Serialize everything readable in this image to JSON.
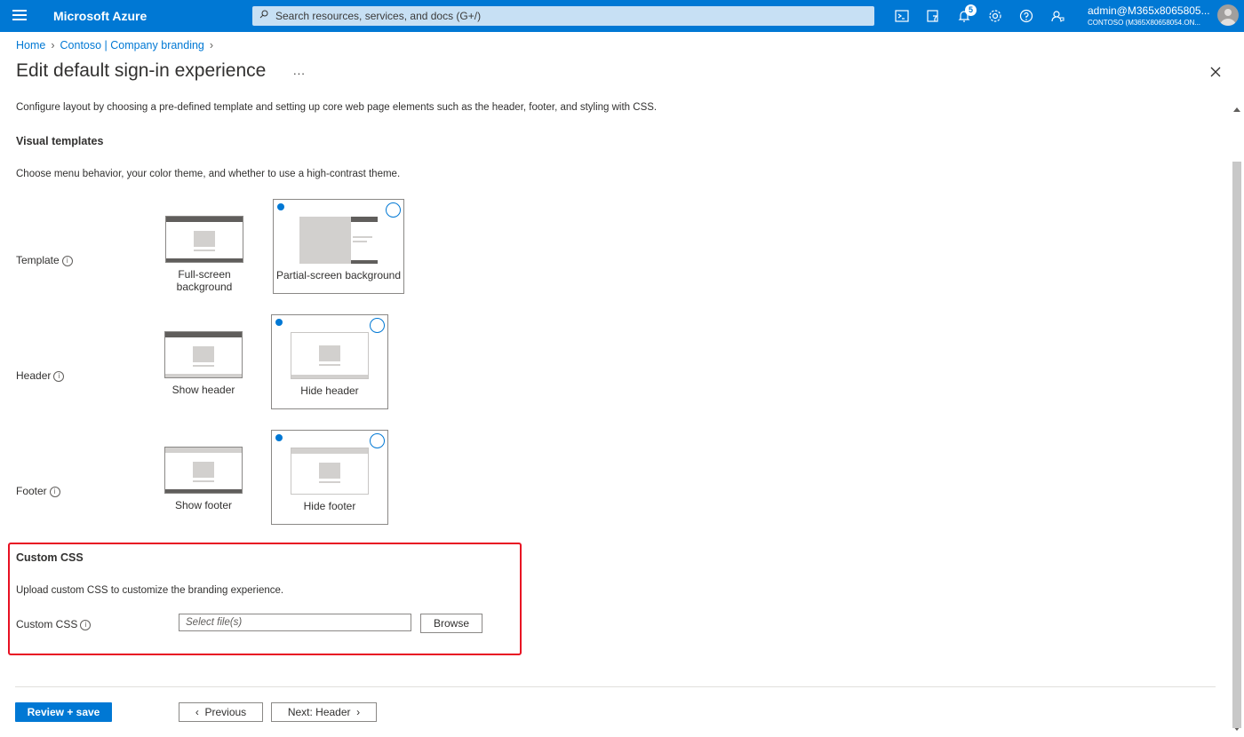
{
  "topbar": {
    "brand": "Microsoft Azure",
    "search_placeholder": "Search resources, services, and docs (G+/)",
    "notification_count": "5",
    "account_user": "admin@M365x8065805...",
    "account_tenant": "CONTOSO (M365X80658054.ON...",
    "icons": [
      "hamburger-icon",
      "search-icon",
      "cloud-shell-icon",
      "directory-filter-icon",
      "notifications-icon",
      "settings-icon",
      "help-icon",
      "feedback-icon",
      "avatar"
    ],
    "color": "#0078d4"
  },
  "breadcrumb": {
    "home": "Home",
    "parent": "Contoso | Company branding"
  },
  "page": {
    "title": "Edit default sign-in experience",
    "more": "...",
    "description": "Configure layout by choosing a pre-defined template and setting up core web page elements such as the header, footer, and styling with CSS."
  },
  "visual_templates": {
    "heading": "Visual templates",
    "description": "Choose menu behavior, your color theme, and whether to use a high-contrast theme.",
    "template": {
      "label": "Template",
      "options": [
        "Full-screen background",
        "Partial-screen background"
      ],
      "selected": "Partial-screen background"
    },
    "header": {
      "label": "Header",
      "options": [
        "Show header",
        "Hide header"
      ],
      "selected": "Hide header"
    },
    "footer": {
      "label": "Footer",
      "options": [
        "Show footer",
        "Hide footer"
      ],
      "selected": "Hide footer"
    }
  },
  "custom_css": {
    "heading": "Custom CSS",
    "description": "Upload custom CSS to customize the branding experience.",
    "label": "Custom CSS",
    "file_placeholder": "Select file(s)",
    "browse": "Browse",
    "highlight_color": "#e81123"
  },
  "footer_buttons": {
    "review_save": "Review + save",
    "previous": "Previous",
    "next": "Next: Header"
  }
}
